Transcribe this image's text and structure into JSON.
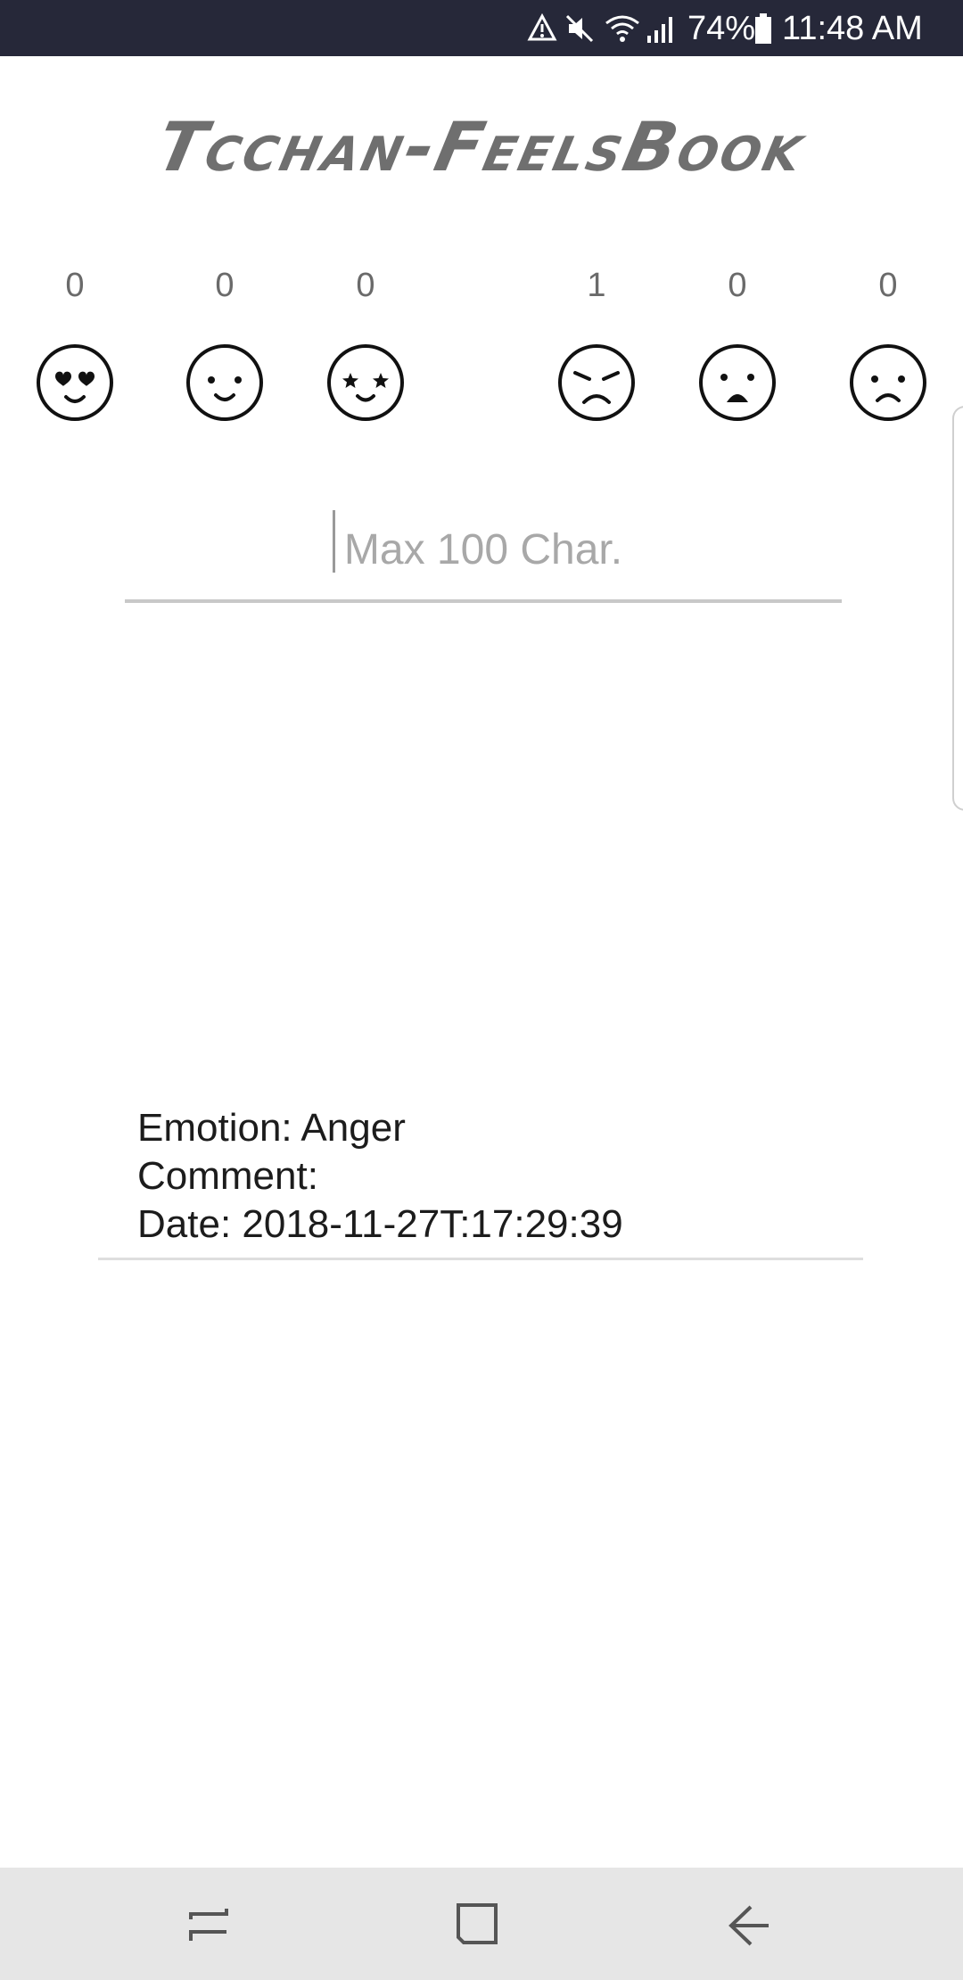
{
  "status_bar": {
    "battery_percent": "74%",
    "time": "11:48 AM",
    "icons": [
      "sync-alert-icon",
      "mute-icon",
      "wifi-icon",
      "signal-icon",
      "battery-icon"
    ]
  },
  "app": {
    "title": "Tcchan-FeelsBook"
  },
  "emotions": [
    {
      "icon": "love-face-icon",
      "count": "0"
    },
    {
      "icon": "joy-face-icon",
      "count": "0"
    },
    {
      "icon": "surprise-face-icon",
      "count": "0"
    },
    {
      "icon": "anger-face-icon",
      "count": "1"
    },
    {
      "icon": "fear-face-icon",
      "count": "0"
    },
    {
      "icon": "sad-face-icon",
      "count": "0"
    }
  ],
  "comment_input": {
    "placeholder": "Max 100 Char.",
    "value": ""
  },
  "entries": [
    {
      "emotion": "Emotion: Anger",
      "comment": "Comment:",
      "date": "Date: 2018-11-27T:17:29:39"
    }
  ],
  "nav_bar": {
    "icons": [
      "recent-apps-icon",
      "home-icon",
      "back-icon"
    ]
  }
}
